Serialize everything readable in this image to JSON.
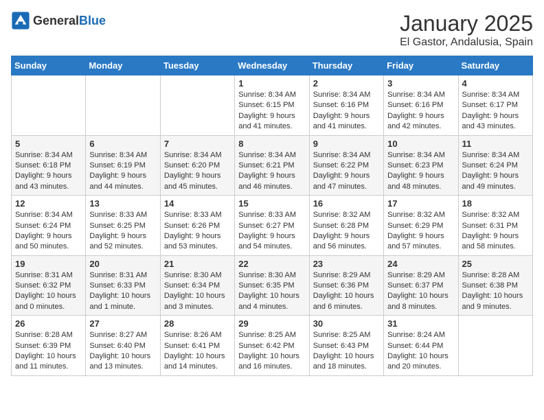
{
  "header": {
    "logo_general": "General",
    "logo_blue": "Blue",
    "month": "January 2025",
    "location": "El Gastor, Andalusia, Spain"
  },
  "days_of_week": [
    "Sunday",
    "Monday",
    "Tuesday",
    "Wednesday",
    "Thursday",
    "Friday",
    "Saturday"
  ],
  "weeks": [
    [
      {
        "day": "",
        "info": ""
      },
      {
        "day": "",
        "info": ""
      },
      {
        "day": "",
        "info": ""
      },
      {
        "day": "1",
        "info": "Sunrise: 8:34 AM\nSunset: 6:15 PM\nDaylight: 9 hours\nand 41 minutes."
      },
      {
        "day": "2",
        "info": "Sunrise: 8:34 AM\nSunset: 6:16 PM\nDaylight: 9 hours\nand 41 minutes."
      },
      {
        "day": "3",
        "info": "Sunrise: 8:34 AM\nSunset: 6:16 PM\nDaylight: 9 hours\nand 42 minutes."
      },
      {
        "day": "4",
        "info": "Sunrise: 8:34 AM\nSunset: 6:17 PM\nDaylight: 9 hours\nand 43 minutes."
      }
    ],
    [
      {
        "day": "5",
        "info": "Sunrise: 8:34 AM\nSunset: 6:18 PM\nDaylight: 9 hours\nand 43 minutes."
      },
      {
        "day": "6",
        "info": "Sunrise: 8:34 AM\nSunset: 6:19 PM\nDaylight: 9 hours\nand 44 minutes."
      },
      {
        "day": "7",
        "info": "Sunrise: 8:34 AM\nSunset: 6:20 PM\nDaylight: 9 hours\nand 45 minutes."
      },
      {
        "day": "8",
        "info": "Sunrise: 8:34 AM\nSunset: 6:21 PM\nDaylight: 9 hours\nand 46 minutes."
      },
      {
        "day": "9",
        "info": "Sunrise: 8:34 AM\nSunset: 6:22 PM\nDaylight: 9 hours\nand 47 minutes."
      },
      {
        "day": "10",
        "info": "Sunrise: 8:34 AM\nSunset: 6:23 PM\nDaylight: 9 hours\nand 48 minutes."
      },
      {
        "day": "11",
        "info": "Sunrise: 8:34 AM\nSunset: 6:24 PM\nDaylight: 9 hours\nand 49 minutes."
      }
    ],
    [
      {
        "day": "12",
        "info": "Sunrise: 8:34 AM\nSunset: 6:24 PM\nDaylight: 9 hours\nand 50 minutes."
      },
      {
        "day": "13",
        "info": "Sunrise: 8:33 AM\nSunset: 6:25 PM\nDaylight: 9 hours\nand 52 minutes."
      },
      {
        "day": "14",
        "info": "Sunrise: 8:33 AM\nSunset: 6:26 PM\nDaylight: 9 hours\nand 53 minutes."
      },
      {
        "day": "15",
        "info": "Sunrise: 8:33 AM\nSunset: 6:27 PM\nDaylight: 9 hours\nand 54 minutes."
      },
      {
        "day": "16",
        "info": "Sunrise: 8:32 AM\nSunset: 6:28 PM\nDaylight: 9 hours\nand 56 minutes."
      },
      {
        "day": "17",
        "info": "Sunrise: 8:32 AM\nSunset: 6:29 PM\nDaylight: 9 hours\nand 57 minutes."
      },
      {
        "day": "18",
        "info": "Sunrise: 8:32 AM\nSunset: 6:31 PM\nDaylight: 9 hours\nand 58 minutes."
      }
    ],
    [
      {
        "day": "19",
        "info": "Sunrise: 8:31 AM\nSunset: 6:32 PM\nDaylight: 10 hours\nand 0 minutes."
      },
      {
        "day": "20",
        "info": "Sunrise: 8:31 AM\nSunset: 6:33 PM\nDaylight: 10 hours\nand 1 minute."
      },
      {
        "day": "21",
        "info": "Sunrise: 8:30 AM\nSunset: 6:34 PM\nDaylight: 10 hours\nand 3 minutes."
      },
      {
        "day": "22",
        "info": "Sunrise: 8:30 AM\nSunset: 6:35 PM\nDaylight: 10 hours\nand 4 minutes."
      },
      {
        "day": "23",
        "info": "Sunrise: 8:29 AM\nSunset: 6:36 PM\nDaylight: 10 hours\nand 6 minutes."
      },
      {
        "day": "24",
        "info": "Sunrise: 8:29 AM\nSunset: 6:37 PM\nDaylight: 10 hours\nand 8 minutes."
      },
      {
        "day": "25",
        "info": "Sunrise: 8:28 AM\nSunset: 6:38 PM\nDaylight: 10 hours\nand 9 minutes."
      }
    ],
    [
      {
        "day": "26",
        "info": "Sunrise: 8:28 AM\nSunset: 6:39 PM\nDaylight: 10 hours\nand 11 minutes."
      },
      {
        "day": "27",
        "info": "Sunrise: 8:27 AM\nSunset: 6:40 PM\nDaylight: 10 hours\nand 13 minutes."
      },
      {
        "day": "28",
        "info": "Sunrise: 8:26 AM\nSunset: 6:41 PM\nDaylight: 10 hours\nand 14 minutes."
      },
      {
        "day": "29",
        "info": "Sunrise: 8:25 AM\nSunset: 6:42 PM\nDaylight: 10 hours\nand 16 minutes."
      },
      {
        "day": "30",
        "info": "Sunrise: 8:25 AM\nSunset: 6:43 PM\nDaylight: 10 hours\nand 18 minutes."
      },
      {
        "day": "31",
        "info": "Sunrise: 8:24 AM\nSunset: 6:44 PM\nDaylight: 10 hours\nand 20 minutes."
      },
      {
        "day": "",
        "info": ""
      }
    ]
  ]
}
